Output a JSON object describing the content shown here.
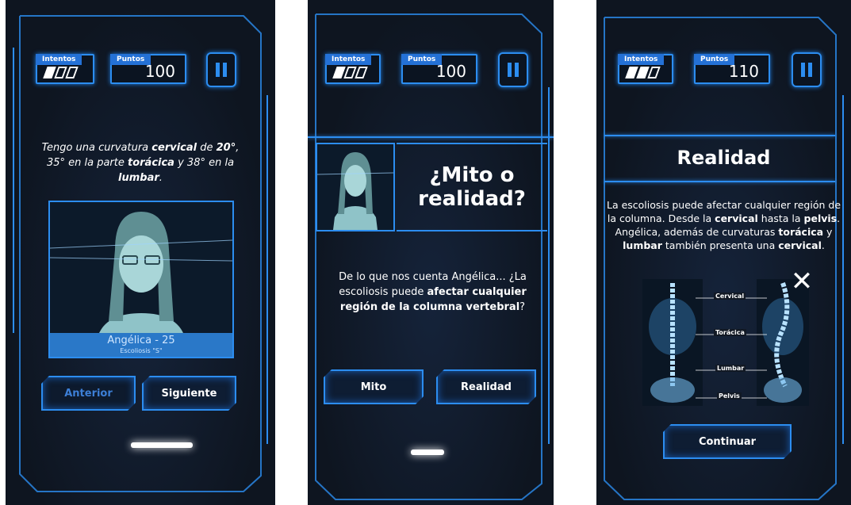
{
  "hud_labels": {
    "tries": "Intentos",
    "points": "Puntos"
  },
  "screen1": {
    "tries_filled": 1,
    "points": "100",
    "statement": {
      "p1": "Tengo una curvatura ",
      "b1": "cervical",
      "p2": " de ",
      "b2": "20°",
      "p3": ", 35° en la parte ",
      "b3": "torácica",
      "p4": " y 38° en la ",
      "b4": "lumbar",
      "p5": "."
    },
    "character_name": "Angélica - 25",
    "character_sub": "Escoliosis \"S\"",
    "buttons": {
      "prev": "Anterior",
      "next": "Siguiente"
    }
  },
  "screen2": {
    "tries_filled": 1,
    "points": "100",
    "title": "¿Mito o realidad?",
    "question": {
      "p1": "De lo que nos cuenta Angélica... ¿La escoliosis puede ",
      "b1": "afectar cualquier región de la columna vertebral",
      "p2": "?"
    },
    "buttons": {
      "myth": "Mito",
      "reality": "Realidad"
    }
  },
  "screen3": {
    "tries_filled": 2,
    "points": "110",
    "title": "Realidad",
    "explanation": {
      "p1": "La escoliosis puede afectar cualquier región de la columna. Desde la ",
      "b1": "cervical",
      "p2": " hasta la ",
      "b2": "pelvis",
      "p3": ". Angélica, además de curvaturas ",
      "b3": "torácica",
      "p4": " y ",
      "b4": "lumbar",
      "p5": " también presenta una ",
      "b5": "cervical",
      "p6": "."
    },
    "xray_labels": [
      "Cervical",
      "Torácica",
      "Lumbar",
      "Pelvis"
    ],
    "button": "Continuar"
  },
  "colors": {
    "accent": "#2c8df0",
    "panel": "#121924",
    "text": "#ffffff"
  }
}
